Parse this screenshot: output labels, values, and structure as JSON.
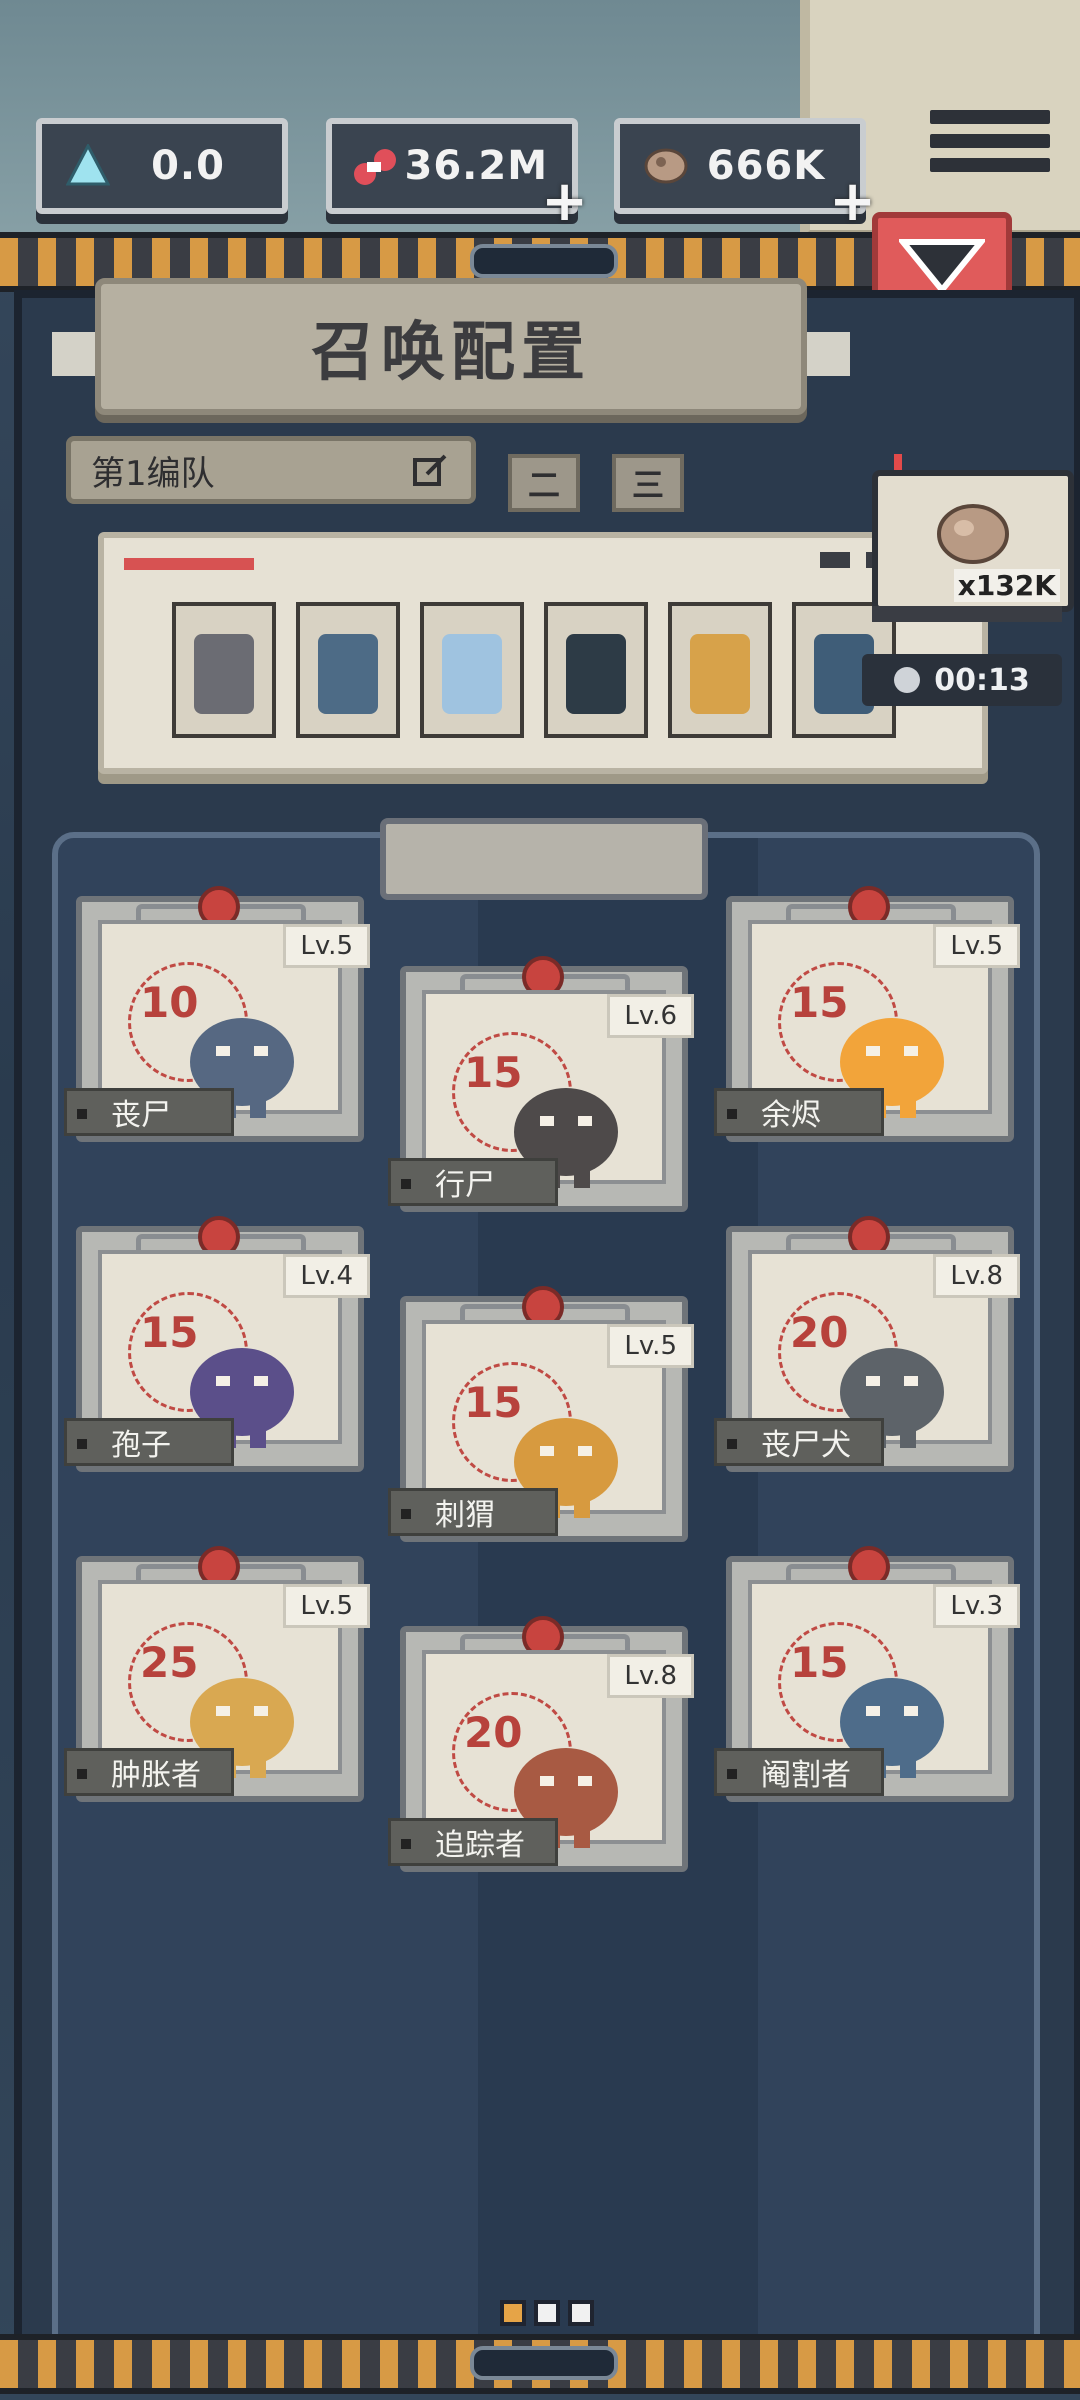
{
  "currencies": [
    {
      "icon": "crystal-icon",
      "value": "0.0",
      "has_plus": false
    },
    {
      "icon": "flesh-icon",
      "value": "36.2M",
      "has_plus": true
    },
    {
      "icon": "ore-icon",
      "value": "666K",
      "has_plus": true
    }
  ],
  "panel": {
    "title": "召唤配置",
    "team_label": "第1编队",
    "team_tabs": [
      "二",
      "三"
    ]
  },
  "chest": {
    "count": "x132K",
    "timer": "00:13"
  },
  "squad_slots": [
    {
      "icon": "dog-zombie-icon",
      "color": "#6b6c73"
    },
    {
      "icon": "walker-icon",
      "color": "#4d6b86"
    },
    {
      "icon": "spirit-icon",
      "color": "#9fc3e0"
    },
    {
      "icon": "shadow-icon",
      "color": "#2d3b46"
    },
    {
      "icon": "hedgehog-icon",
      "color": "#d7a24a"
    },
    {
      "icon": "zombie-icon",
      "color": "#3f5d78"
    }
  ],
  "units": [
    {
      "name": "丧尸",
      "level": "Lv.5",
      "cost": "10",
      "icon": "zombie-icon",
      "color": "#566882"
    },
    {
      "name": "行尸",
      "level": "Lv.6",
      "cost": "15",
      "icon": "walker-icon",
      "color": "#4e4a4a"
    },
    {
      "name": "余烬",
      "level": "Lv.5",
      "cost": "15",
      "icon": "ember-icon",
      "color": "#f2a43a"
    },
    {
      "name": "孢子",
      "level": "Lv.4",
      "cost": "15",
      "icon": "spore-icon",
      "color": "#5b4f8a"
    },
    {
      "name": "刺猬",
      "level": "Lv.5",
      "cost": "15",
      "icon": "hedgehog-icon",
      "color": "#d79a3f"
    },
    {
      "name": "丧尸犬",
      "level": "Lv.8",
      "cost": "20",
      "icon": "dog-zombie-icon",
      "color": "#5d6369"
    },
    {
      "name": "肿胀者",
      "level": "Lv.5",
      "cost": "25",
      "icon": "bloater-icon",
      "color": "#d9a851"
    },
    {
      "name": "追踪者",
      "level": "Lv.8",
      "cost": "20",
      "icon": "tracker-icon",
      "color": "#a85a43"
    },
    {
      "name": "阉割者",
      "level": "Lv.3",
      "cost": "15",
      "icon": "crawler-icon",
      "color": "#4e6c8a"
    }
  ],
  "pager": {
    "pages": 3,
    "current": 1
  }
}
